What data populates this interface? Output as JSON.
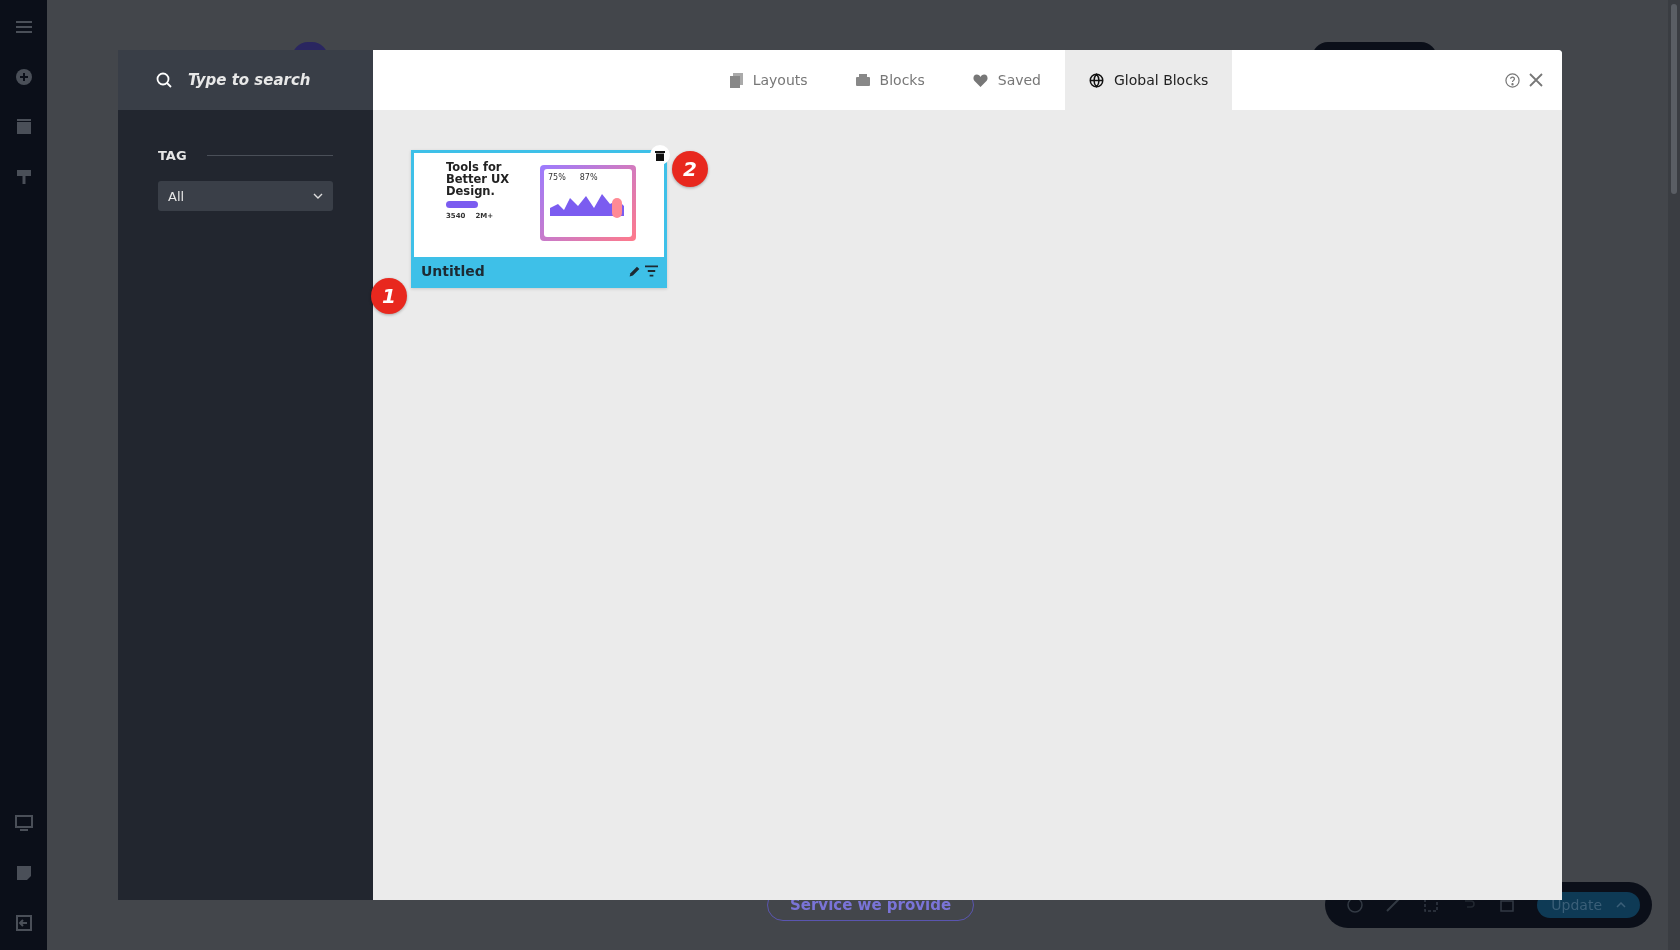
{
  "search": {
    "placeholder": "Type to search"
  },
  "filter": {
    "label": "TAG",
    "value": "All"
  },
  "tabs": [
    {
      "label": "Layouts",
      "selected": false
    },
    {
      "label": "Blocks",
      "selected": false
    },
    {
      "label": "Saved",
      "selected": false
    },
    {
      "label": "Global Blocks",
      "selected": true
    }
  ],
  "items": [
    {
      "title": "Untitled",
      "title_marker": "1",
      "delete_marker": "2",
      "preview": {
        "heading": "Tools for Better UX Design.",
        "stats": [
          "3540",
          "2M+"
        ],
        "metrics": [
          "75%",
          "87%"
        ]
      }
    }
  ],
  "background_page": {
    "button": "Service we provide",
    "toolbar_button": "Update"
  }
}
